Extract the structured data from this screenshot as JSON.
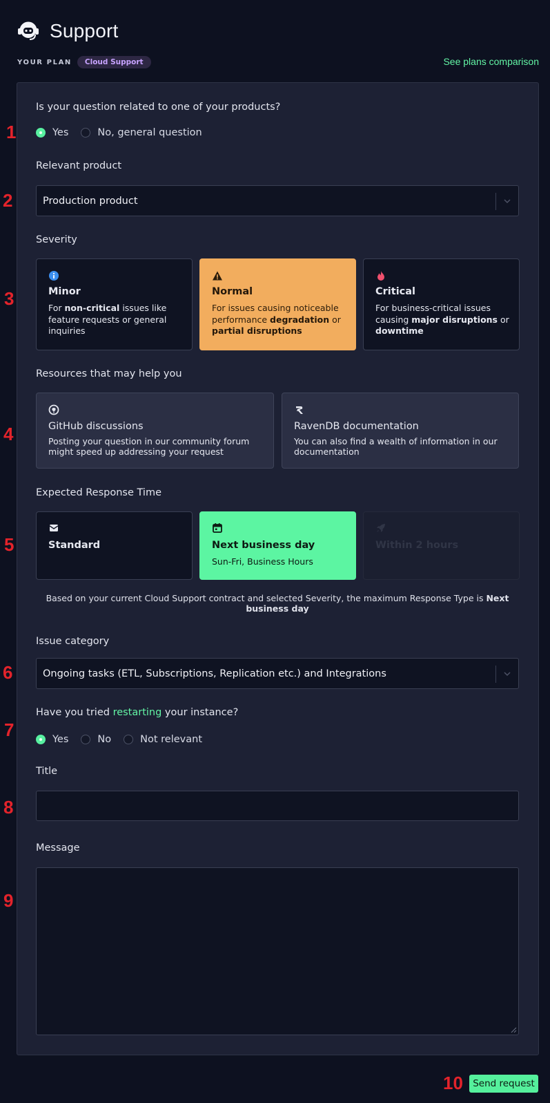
{
  "header": {
    "title": "Support",
    "icon": "headset-robot-icon"
  },
  "plan": {
    "label": "YOUR PLAN",
    "badge": "Cloud Support",
    "link": "See plans comparison"
  },
  "markers": [
    "1",
    "2",
    "3",
    "4",
    "5",
    "6",
    "7",
    "8",
    "9",
    "10"
  ],
  "q1": {
    "label": "Is your question related to one of your products?",
    "options": [
      "Yes",
      "No, general question"
    ],
    "selected": "Yes"
  },
  "product": {
    "label": "Relevant product",
    "value": "Production product"
  },
  "severity": {
    "label": "Severity",
    "options": [
      {
        "icon": "info-icon",
        "title": "Minor",
        "desc_pre": "For ",
        "desc_b1": "non-critical",
        "desc_mid": " issues like feature requests or general inquiries",
        "desc_b2": "",
        "desc_mid2": "",
        "desc_b3": ""
      },
      {
        "icon": "warning-icon",
        "title": "Normal",
        "desc_pre": "For issues causing noticeable performance ",
        "desc_b1": "degradation",
        "desc_mid": " or ",
        "desc_b2": "partial disruptions",
        "desc_mid2": "",
        "desc_b3": ""
      },
      {
        "icon": "fire-icon",
        "title": "Critical",
        "desc_pre": "For business-critical issues causing ",
        "desc_b1": "major disruptions",
        "desc_mid": " or ",
        "desc_b2": "downtime",
        "desc_mid2": "",
        "desc_b3": ""
      }
    ],
    "selected": "Normal",
    "colors": {
      "selected": "#f2ad5e",
      "info": "#3b8ff0",
      "fire": "#f0506e"
    }
  },
  "resources": {
    "label": "Resources that may help you",
    "items": [
      {
        "icon": "github-icon",
        "title": "GitHub discussions",
        "desc": "Posting your question in our community forum might speed up addressing your request"
      },
      {
        "icon": "ravendb-icon",
        "title": "RavenDB documentation",
        "desc": "You can also find a wealth of information in our documentation"
      }
    ]
  },
  "response": {
    "label": "Expected Response Time",
    "options": [
      {
        "icon": "envelope-icon",
        "title": "Standard",
        "desc": "",
        "state": "available"
      },
      {
        "icon": "calendar-icon",
        "title": "Next business day",
        "desc": "Sun-Fri, Business Hours",
        "state": "selected"
      },
      {
        "icon": "rocket-icon",
        "title": "Within 2 hours",
        "desc": "",
        "state": "disabled"
      }
    ],
    "note_pre": "Based on your current Cloud Support contract and selected Severity, the maximum Response Type is ",
    "note_b": "Next business day",
    "colors": {
      "selected": "#5cf5a2"
    }
  },
  "category": {
    "label": "Issue category",
    "value": "Ongoing tasks (ETL, Subscriptions, Replication etc.) and Integrations"
  },
  "restart": {
    "pre": "Have you tried ",
    "link": "restarting",
    "post": " your instance?",
    "options": [
      "Yes",
      "No",
      "Not relevant"
    ],
    "selected": "Yes"
  },
  "title_field": {
    "label": "Title",
    "value": ""
  },
  "message_field": {
    "label": "Message",
    "value": ""
  },
  "send": {
    "label": "Send request"
  },
  "colors": {
    "accent": "#5cf5a2",
    "marker": "#e3232b",
    "badge_text": "#c7a3ff"
  }
}
